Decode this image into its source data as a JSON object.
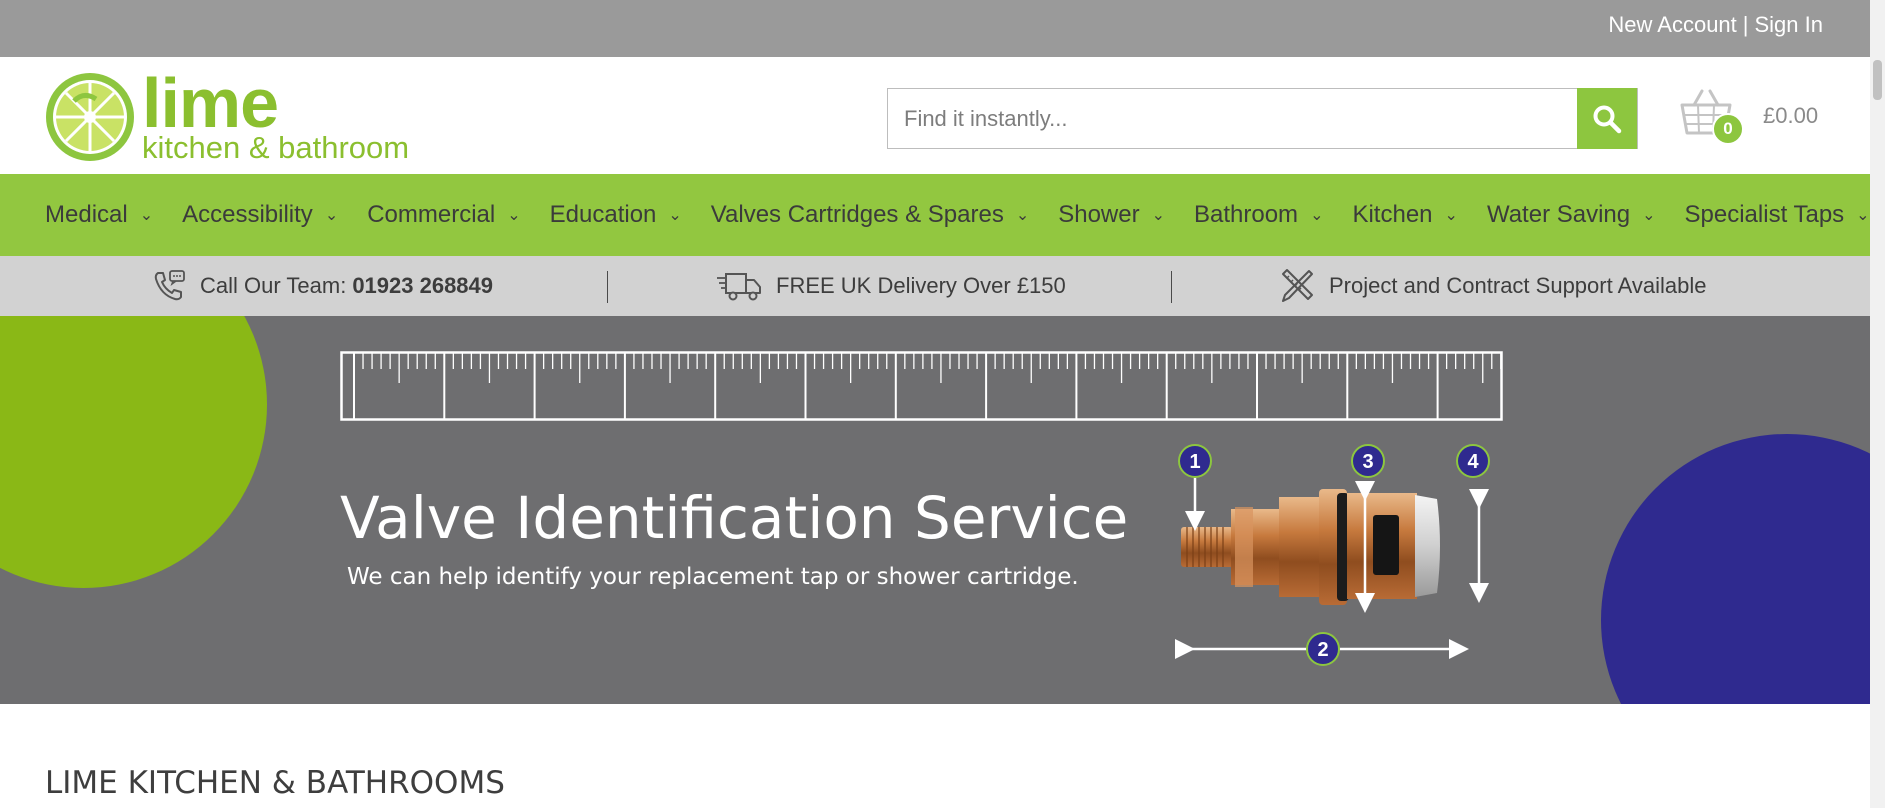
{
  "topbar": {
    "new_account": "New Account",
    "separator": "|",
    "sign_in": "Sign In"
  },
  "logo": {
    "word": "lime",
    "tagline": "kitchen & bathroom"
  },
  "search": {
    "placeholder": "Find it instantly..."
  },
  "basket": {
    "count": "0",
    "total": "£0.00"
  },
  "nav": {
    "items": [
      {
        "label": "Medical"
      },
      {
        "label": "Accessibility"
      },
      {
        "label": "Commercial"
      },
      {
        "label": "Education"
      },
      {
        "label": "Valves Cartridges & Spares"
      },
      {
        "label": "Shower"
      },
      {
        "label": "Bathroom"
      },
      {
        "label": "Kitchen"
      },
      {
        "label": "Water Saving"
      },
      {
        "label": "Specialist Taps"
      }
    ],
    "chevron": "⌄"
  },
  "infobar": {
    "call_label": "Call Our Team:",
    "call_number": "01923 268849",
    "delivery": "FREE UK Delivery Over £150",
    "support": "Project and Contract Support Available"
  },
  "hero": {
    "title": "Valve Identification Service",
    "subtitle": "We can help identify your replacement tap or shower cartridge.",
    "markers": [
      "1",
      "2",
      "3",
      "4"
    ]
  },
  "section": {
    "title": "LIME KITCHEN & BATHROOMS"
  },
  "colors": {
    "brand_green": "#8dc63f",
    "nav_green": "#92c740",
    "hero_grey": "#6e6e70",
    "accent_blue": "#2f2a8f",
    "topbar_grey": "#9a9a9a",
    "infobar_grey": "#d2d2d2"
  }
}
